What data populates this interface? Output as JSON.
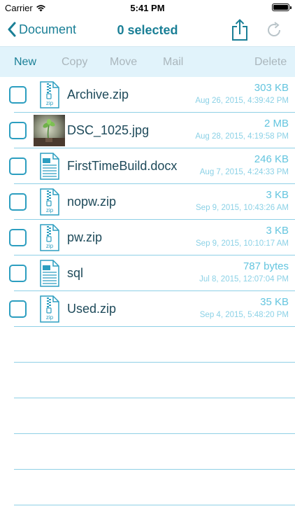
{
  "status_bar": {
    "carrier": "Carrier",
    "time": "5:41 PM",
    "wifi_icon": "wifi-icon",
    "battery_icon": "battery-icon"
  },
  "nav": {
    "back_label": "Document",
    "title": "0 selected",
    "back_icon": "chevron-left-icon",
    "share_icon": "share-icon",
    "refresh_icon": "refresh-icon"
  },
  "toolbar": {
    "new_label": "New",
    "copy_label": "Copy",
    "move_label": "Move",
    "mail_label": "Mail",
    "delete_label": "Delete"
  },
  "files": [
    {
      "name": "Archive.zip",
      "size": "303 KB",
      "date": "Aug 26, 2015, 4:39:42 PM",
      "icon": "zip-file-icon"
    },
    {
      "name": "DSC_1025.jpg",
      "size": "2 MB",
      "date": "Aug 28, 2015, 4:19:58 PM",
      "icon": "image-thumbnail"
    },
    {
      "name": "FirstTimeBuild.docx",
      "size": "246 KB",
      "date": "Aug 7, 2015, 4:24:33 PM",
      "icon": "document-file-icon"
    },
    {
      "name": "nopw.zip",
      "size": "3 KB",
      "date": "Sep 9, 2015, 10:43:26 AM",
      "icon": "zip-file-icon"
    },
    {
      "name": "pw.zip",
      "size": "3 KB",
      "date": "Sep 9, 2015, 10:10:17 AM",
      "icon": "zip-file-icon"
    },
    {
      "name": "sql",
      "size": "787 bytes",
      "date": "Jul 8, 2015, 12:07:04 PM",
      "icon": "document-file-icon"
    },
    {
      "name": "Used.zip",
      "size": "35 KB",
      "date": "Sep 4, 2015, 5:48:20 PM",
      "icon": "zip-file-icon"
    }
  ],
  "zip_icon_label": "zip",
  "colors": {
    "accent": "#1a7f96",
    "toolbar_bg": "#e1f3fb",
    "separator": "#8fd0e6",
    "meta_text": "#64c5df",
    "disabled": "#aab6bc"
  }
}
